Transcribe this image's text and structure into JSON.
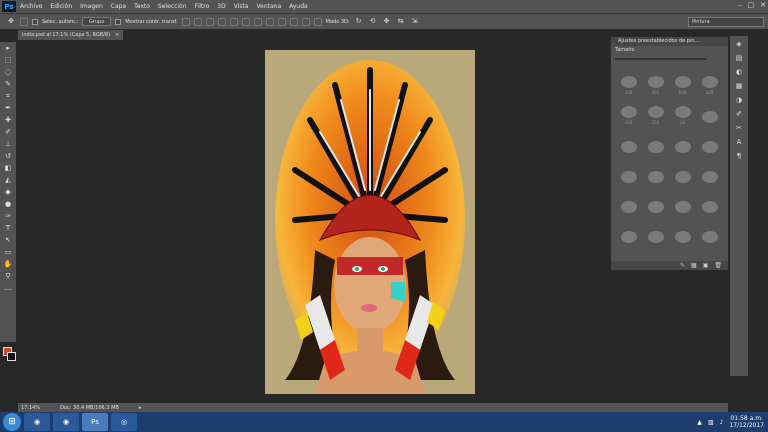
{
  "app": {
    "logo": "Ps"
  },
  "menu": [
    "Archivo",
    "Edición",
    "Imagen",
    "Capa",
    "Texto",
    "Selección",
    "Filtro",
    "3D",
    "Vista",
    "Ventana",
    "Ayuda"
  ],
  "options": {
    "auto_select_label": "Selec. autom.:",
    "group_value": "Grupo",
    "show_transform_label": "Mostrar contr. transf.",
    "mode3d_label": "Modo 3D:",
    "workspace_value": "Pintura"
  },
  "document": {
    "tab_label": "india.psd al 17,1% (Capa 5, RGB/8)",
    "close": "×"
  },
  "status": {
    "zoom": "17,14%",
    "doc_size": "Doc: 30,4 MB/166,3 MB"
  },
  "panel": {
    "title": "Ajustes preestablecidos de pin...",
    "size_label": "Tamaño",
    "brush_sizes": [
      "100",
      "491",
      "100",
      "425",
      "420",
      "155",
      "24",
      "",
      "",
      "",
      "",
      "",
      "",
      "",
      "",
      "",
      "",
      "",
      "",
      "",
      "",
      "",
      "",
      ""
    ]
  },
  "taskbar": {
    "time": "01:58 a.m.",
    "date": "17/12/2017"
  },
  "colors": {
    "foreground": "#c84a2a",
    "background": "#111111",
    "accent": "#31a8ff"
  }
}
